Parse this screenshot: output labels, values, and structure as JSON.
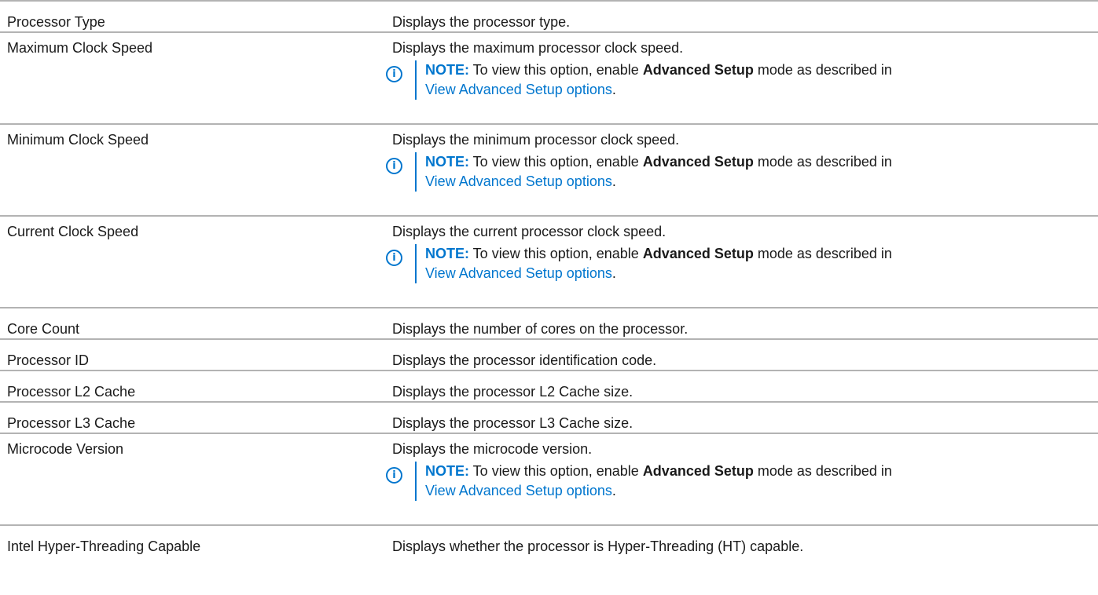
{
  "note": {
    "label": "NOTE:",
    "text_before": " To view this option, enable ",
    "bold": "Advanced Setup",
    "text_after": " mode as described in",
    "link": "View Advanced Setup options",
    "end": "."
  },
  "rows": [
    {
      "setting": "Processor Type",
      "description": "Displays the processor type."
    },
    {
      "setting": "Maximum Clock Speed",
      "description": "Displays the maximum processor clock speed."
    },
    {
      "setting": "Minimum Clock Speed",
      "description": "Displays the minimum processor clock speed."
    },
    {
      "setting": "Current Clock Speed",
      "description": "Displays the current processor clock speed."
    },
    {
      "setting": "Core Count",
      "description": "Displays the number of cores on the processor."
    },
    {
      "setting": "Processor ID",
      "description": "Displays the processor identification code."
    },
    {
      "setting": "Processor L2 Cache",
      "description": "Displays the processor L2 Cache size."
    },
    {
      "setting": "Processor L3 Cache",
      "description": "Displays the processor L3 Cache size."
    },
    {
      "setting": "Microcode Version",
      "description": "Displays the microcode version."
    },
    {
      "setting": "Intel Hyper-Threading Capable",
      "description": "Displays whether the processor is Hyper-Threading (HT) capable."
    }
  ],
  "colors": {
    "accent": "#0076ce",
    "rule": "#b3b3b3"
  },
  "icons": {
    "note": "info-icon"
  }
}
